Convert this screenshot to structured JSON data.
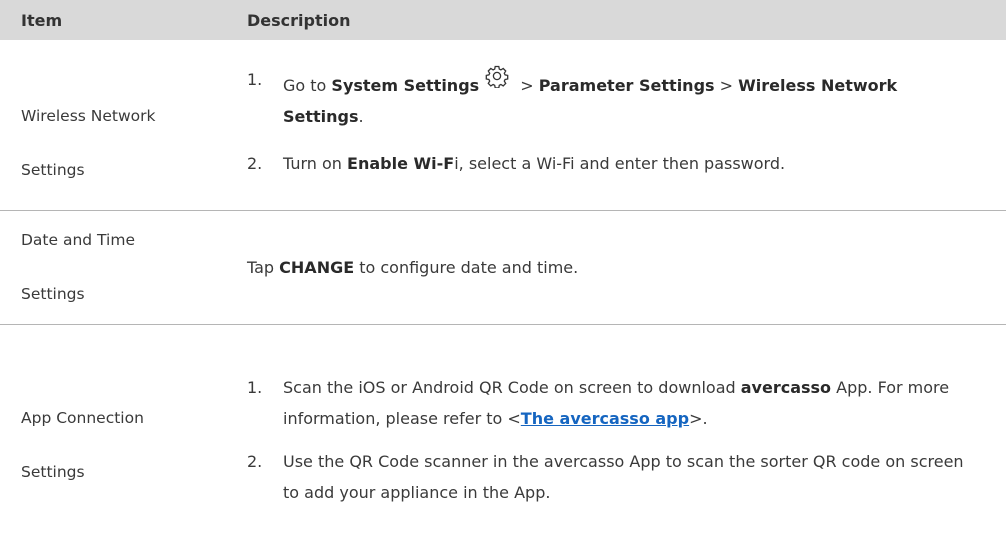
{
  "header": {
    "item": "Item",
    "description": "Description"
  },
  "rows": [
    {
      "item_line1": "Wireless Network",
      "item_line2": "Settings",
      "step1": {
        "num": "1.",
        "pre": "Go to ",
        "b1": "System Settings",
        "icon": "gear-icon",
        "sep1": " > ",
        "b2": "Parameter Settings",
        "sep2": " > ",
        "b3": "Wireless Network Settings",
        "end": "."
      },
      "step2": {
        "num": "2.",
        "pre": "Turn on ",
        "b1": "Enable Wi-F",
        "post": "i, select a Wi-Fi and enter then password."
      }
    },
    {
      "item_line1": "Date and Time",
      "item_line2": "Settings",
      "pre": "Tap ",
      "b1": "CHANGE",
      "post": " to configure date and time."
    },
    {
      "item_line1": "App Connection",
      "item_line2": "Settings",
      "step1": {
        "num": "1.",
        "pre": "Scan the iOS or Android QR Code on screen to download ",
        "b1": "avercasso",
        "mid": " App. For more information, please refer to <",
        "link": "The avercasso app",
        "end": ">."
      },
      "step2": {
        "num": "2.",
        "text": "Use the QR Code scanner in the avercasso App to scan the sorter QR code on screen to add your appliance in the App."
      }
    }
  ]
}
